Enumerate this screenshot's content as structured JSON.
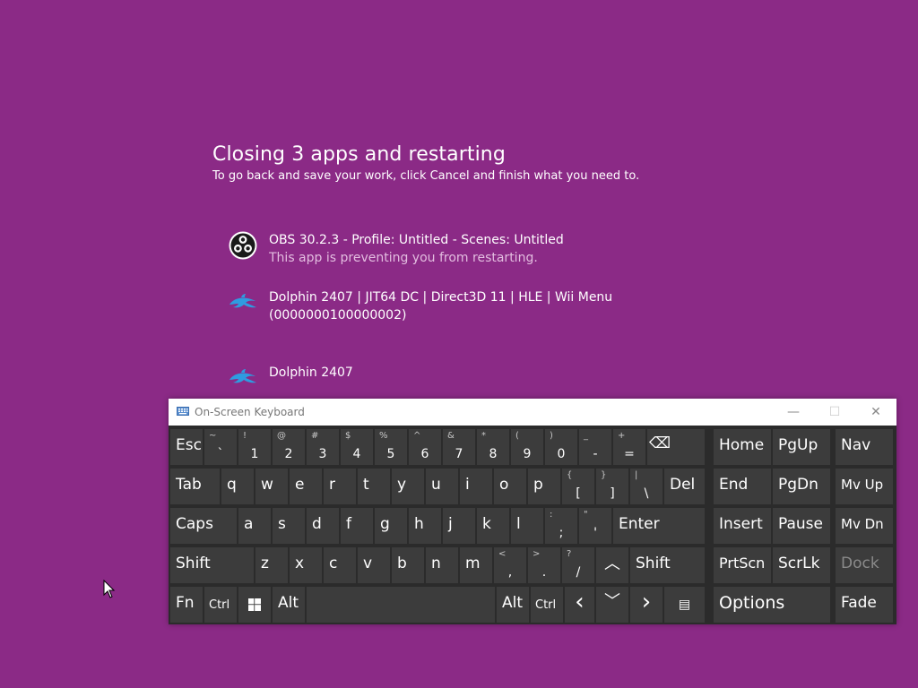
{
  "shutdown": {
    "title": "Closing 3 apps and restarting",
    "subtitle": "To go back and save your work, click Cancel and finish what you need to.",
    "apps": [
      {
        "name": "OBS 30.2.3 - Profile: Untitled - Scenes: Untitled",
        "status": "This app is preventing you from restarting.",
        "icon": "obs-icon"
      },
      {
        "name": "Dolphin 2407 | JIT64 DC | Direct3D 11 | HLE | Wii Menu",
        "name2": "(0000000100000002)",
        "icon": "dolphin-icon"
      },
      {
        "name": "Dolphin 2407",
        "icon": "dolphin-icon"
      }
    ]
  },
  "osk": {
    "title": "On-Screen Keyboard",
    "minimize": "—",
    "maximize": "☐",
    "close": "✕",
    "keys": {
      "esc": "Esc",
      "n1": {
        "sec": "!",
        "pri": "1"
      },
      "n2": {
        "sec": "@",
        "pri": "2"
      },
      "n3": {
        "sec": "#",
        "pri": "3"
      },
      "n4": {
        "sec": "$",
        "pri": "4"
      },
      "n5": {
        "sec": "%",
        "pri": "5"
      },
      "n6": {
        "sec": "^",
        "pri": "6"
      },
      "n7": {
        "sec": "&",
        "pri": "7"
      },
      "n8": {
        "sec": "*",
        "pri": "8"
      },
      "n9": {
        "sec": "(",
        "pri": "9"
      },
      "n0": {
        "sec": ")",
        "pri": "0"
      },
      "minus": {
        "sec": "_",
        "pri": "-"
      },
      "equals": {
        "sec": "+",
        "pri": "="
      },
      "tilde": {
        "sec": "~",
        "pri": "`"
      },
      "backspace": "⌫",
      "tab": "Tab",
      "q": "q",
      "w": "w",
      "e": "e",
      "r": "r",
      "t": "t",
      "y": "y",
      "u": "u",
      "i": "i",
      "o": "o",
      "p": "p",
      "lbracket": {
        "sec": "{",
        "pri": "["
      },
      "rbracket": {
        "sec": "}",
        "pri": "]"
      },
      "backslash": {
        "sec": "|",
        "pri": "\\"
      },
      "del": "Del",
      "caps": "Caps",
      "a": "a",
      "s": "s",
      "d": "d",
      "f": "f",
      "g": "g",
      "h": "h",
      "j": "j",
      "k": "k",
      "l": "l",
      "semicolon": {
        "sec": ":",
        "pri": ";"
      },
      "quote": {
        "sec": "\"",
        "pri": "'"
      },
      "enter": "Enter",
      "shift_l": "Shift",
      "z": "z",
      "x": "x",
      "c": "c",
      "v": "v",
      "b": "b",
      "n": "n",
      "m": "m",
      "comma": {
        "sec": "<",
        "pri": ","
      },
      "period": {
        "sec": ">",
        "pri": "."
      },
      "slash": {
        "sec": "?",
        "pri": "/"
      },
      "up": "︿",
      "shift_r": "Shift",
      "fn": "Fn",
      "ctrl_l": "Ctrl",
      "alt_l": "Alt",
      "alt_r": "Alt",
      "ctrl_r": "Ctrl",
      "left": "‹",
      "down": "﹀",
      "right": "›",
      "menu": "▤",
      "home": "Home",
      "pgup": "PgUp",
      "nav": "Nav",
      "end": "End",
      "pgdn": "PgDn",
      "mvup": "Mv Up",
      "insert": "Insert",
      "pause": "Pause",
      "mvdn": "Mv Dn",
      "prtscn": "PrtScn",
      "scrlk": "ScrLk",
      "dock": "Dock",
      "options": "Options",
      "fade": "Fade"
    }
  }
}
